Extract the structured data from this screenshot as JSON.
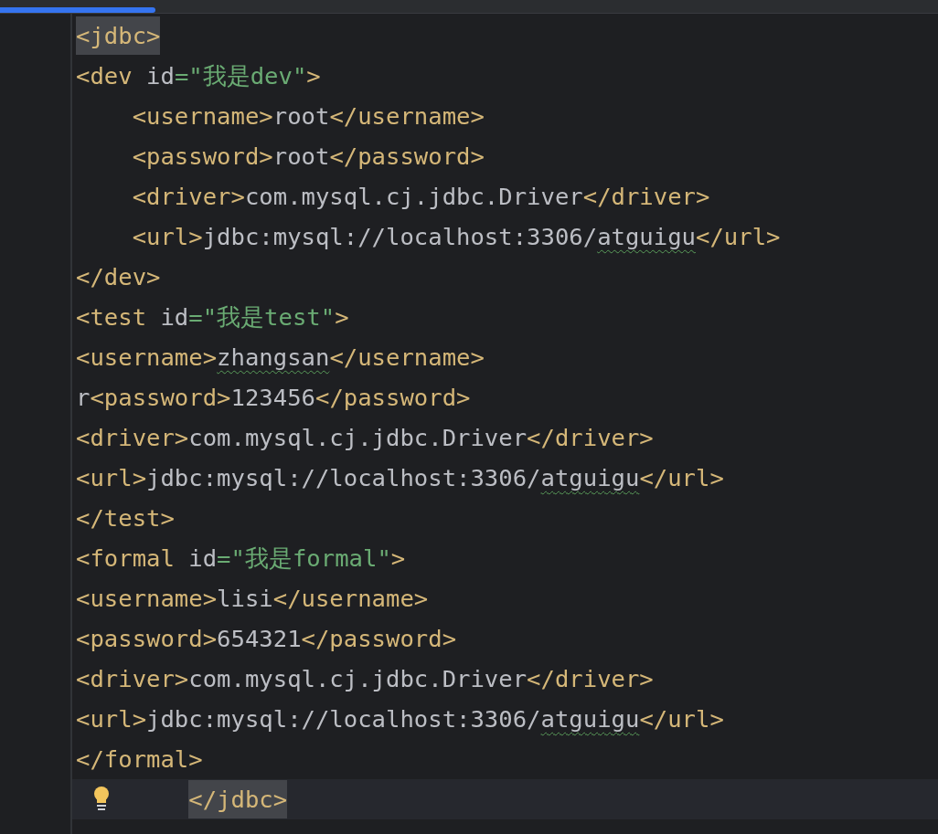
{
  "editor": {
    "lines": [
      {
        "current": false,
        "tokens": [
          {
            "kind": "tag",
            "text": "<jdbc>",
            "matched": true
          }
        ]
      },
      {
        "current": false,
        "tokens": [
          {
            "kind": "tag",
            "text": "<dev "
          },
          {
            "kind": "attr",
            "text": "id"
          },
          {
            "kind": "string",
            "text": "=\"我是dev\""
          },
          {
            "kind": "tag",
            "text": ">"
          }
        ]
      },
      {
        "current": false,
        "tokens": [
          {
            "kind": "tag",
            "text": "    <username>"
          },
          {
            "kind": "text",
            "text": "root"
          },
          {
            "kind": "tag",
            "text": "</username>"
          }
        ]
      },
      {
        "current": false,
        "tokens": [
          {
            "kind": "tag",
            "text": "    <password>"
          },
          {
            "kind": "text",
            "text": "root"
          },
          {
            "kind": "tag",
            "text": "</password>"
          }
        ]
      },
      {
        "current": false,
        "tokens": [
          {
            "kind": "tag",
            "text": "    <driver>"
          },
          {
            "kind": "text",
            "text": "com.mysql.cj.jdbc.Driver"
          },
          {
            "kind": "tag",
            "text": "</driver>"
          }
        ]
      },
      {
        "current": false,
        "tokens": [
          {
            "kind": "tag",
            "text": "    <url>"
          },
          {
            "kind": "text",
            "text": "jdbc:mysql://localhost:3306/"
          },
          {
            "kind": "typo",
            "text": "atguigu"
          },
          {
            "kind": "tag",
            "text": "</url>"
          }
        ]
      },
      {
        "current": false,
        "tokens": [
          {
            "kind": "tag",
            "text": "</dev>"
          }
        ]
      },
      {
        "current": false,
        "tokens": [
          {
            "kind": "tag",
            "text": "<test "
          },
          {
            "kind": "attr",
            "text": "id"
          },
          {
            "kind": "string",
            "text": "=\"我是test\""
          },
          {
            "kind": "tag",
            "text": ">"
          }
        ]
      },
      {
        "current": false,
        "tokens": [
          {
            "kind": "tag",
            "text": "<username>"
          },
          {
            "kind": "typo",
            "text": "zhangsan"
          },
          {
            "kind": "tag",
            "text": "</username>"
          }
        ]
      },
      {
        "current": false,
        "tokens": [
          {
            "kind": "text",
            "text": "r"
          },
          {
            "kind": "tag",
            "text": "<password>"
          },
          {
            "kind": "text",
            "text": "123456"
          },
          {
            "kind": "tag",
            "text": "</password>"
          }
        ]
      },
      {
        "current": false,
        "tokens": [
          {
            "kind": "tag",
            "text": "<driver>"
          },
          {
            "kind": "text",
            "text": "com.mysql.cj.jdbc.Driver"
          },
          {
            "kind": "tag",
            "text": "</driver>"
          }
        ]
      },
      {
        "current": false,
        "tokens": [
          {
            "kind": "tag",
            "text": "<url>"
          },
          {
            "kind": "text",
            "text": "jdbc:mysql://localhost:3306/"
          },
          {
            "kind": "typo",
            "text": "atguigu"
          },
          {
            "kind": "tag",
            "text": "</url>"
          }
        ]
      },
      {
        "current": false,
        "tokens": [
          {
            "kind": "tag",
            "text": "</test>"
          }
        ]
      },
      {
        "current": false,
        "tokens": [
          {
            "kind": "tag",
            "text": "<formal "
          },
          {
            "kind": "attr",
            "text": "id"
          },
          {
            "kind": "string",
            "text": "=\"我是formal\""
          },
          {
            "kind": "tag",
            "text": ">"
          }
        ]
      },
      {
        "current": false,
        "tokens": [
          {
            "kind": "tag",
            "text": "<username>"
          },
          {
            "kind": "text",
            "text": "lisi"
          },
          {
            "kind": "tag",
            "text": "</username>"
          }
        ]
      },
      {
        "current": false,
        "tokens": [
          {
            "kind": "tag",
            "text": "<password>"
          },
          {
            "kind": "text",
            "text": "654321"
          },
          {
            "kind": "tag",
            "text": "</password>"
          }
        ]
      },
      {
        "current": false,
        "tokens": [
          {
            "kind": "tag",
            "text": "<driver>"
          },
          {
            "kind": "text",
            "text": "com.mysql.cj.jdbc.Driver"
          },
          {
            "kind": "tag",
            "text": "</driver>"
          }
        ]
      },
      {
        "current": false,
        "tokens": [
          {
            "kind": "tag",
            "text": "<url>"
          },
          {
            "kind": "text",
            "text": "jdbc:mysql://localhost:3306/"
          },
          {
            "kind": "typo",
            "text": "atguigu"
          },
          {
            "kind": "tag",
            "text": "</url>"
          }
        ]
      },
      {
        "current": false,
        "tokens": [
          {
            "kind": "tag",
            "text": "</formal>"
          }
        ]
      },
      {
        "current": true,
        "tokens": [
          {
            "kind": "tag",
            "text": "        </jdbc>",
            "matched": true
          }
        ]
      }
    ]
  }
}
